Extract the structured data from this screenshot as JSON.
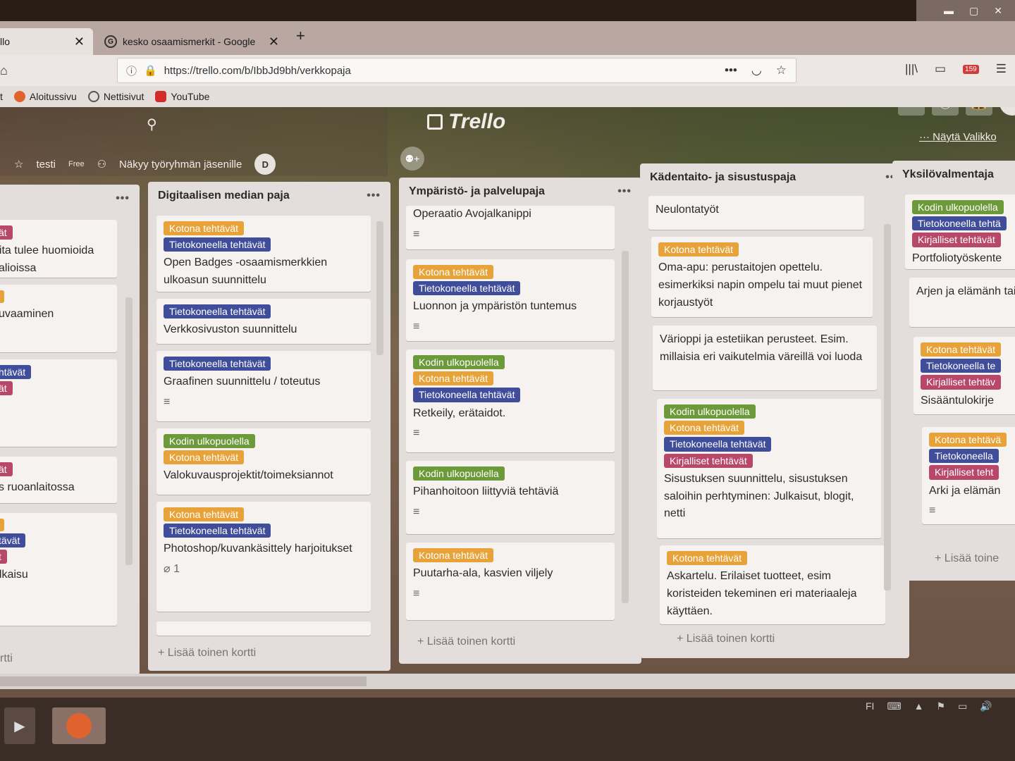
{
  "browser": {
    "tabs": [
      {
        "title": "llo",
        "close": "✕"
      },
      {
        "title": "kesko osaamismerkit - Google",
        "close": "✕"
      }
    ],
    "new_tab": "+",
    "url": "https://trello.com/b/IbbJd9bh/verkkopaja",
    "bookmarks": [
      "Aloitussivu",
      "Nettisivut",
      "YouTube"
    ],
    "notification_count": "159"
  },
  "board": {
    "name": "testi",
    "plan": "Free",
    "visibility": "Näkyy työryhmän jäsenille",
    "member_initial": "D",
    "logo": "Trello",
    "menu_link": "Näytä Valikko",
    "top_avatar": "D"
  },
  "lists": [
    {
      "title": "",
      "cards": [
        {
          "labels": [
            {
              "text": "ät",
              "color": "red"
            }
          ],
          "text": "oita tulee huomioida valioissa"
        },
        {
          "labels": [
            {
              "text": "",
              "color": "orange"
            }
          ],
          "text": "kuvaaminen"
        },
        {
          "labels": [
            {
              "text": "htävät",
              "color": "blue"
            },
            {
              "text": "ät",
              "color": "red"
            }
          ],
          "text": ""
        },
        {
          "labels": [
            {
              "text": "ät",
              "color": "red"
            }
          ],
          "text": "ys ruoanlaitossa"
        },
        {
          "labels": [
            {
              "text": "",
              "color": "orange"
            },
            {
              "text": "tävät",
              "color": "blue"
            },
            {
              "text": "t",
              "color": "red"
            }
          ],
          "text": "ulkaisu"
        }
      ],
      "add": "rtti"
    },
    {
      "title": "Digitaalisen median paja",
      "cards": [
        {
          "labels": [
            {
              "text": "Kotona tehtävät",
              "color": "orange"
            },
            {
              "text": "Tietokoneella tehtävät",
              "color": "blue"
            }
          ],
          "text": "Open Badges -osaamismerkkien ulkoasun suunnittelu"
        },
        {
          "labels": [
            {
              "text": "Tietokoneella tehtävät",
              "color": "blue"
            }
          ],
          "text": "Verkkosivuston suunnittelu"
        },
        {
          "labels": [
            {
              "text": "Tietokoneella tehtävät",
              "color": "blue"
            }
          ],
          "text": "Graafinen suunnittelu / toteutus"
        },
        {
          "labels": [
            {
              "text": "Kodin ulkopuolella",
              "color": "green"
            },
            {
              "text": "Kotona tehtävät",
              "color": "orange"
            }
          ],
          "text": "Valokuvausprojektit/toimeksiannot"
        },
        {
          "labels": [
            {
              "text": "Kotona tehtävät",
              "color": "orange"
            },
            {
              "text": "Tietokoneella tehtävät",
              "color": "blue"
            }
          ],
          "text": "Photoshop/kuvankäsittely harjoitukset",
          "attachments": "1"
        }
      ],
      "add": "+ Lisää toinen kortti"
    },
    {
      "title": "Ympäristö- ja palvelupaja",
      "cards": [
        {
          "labels": [],
          "text": "Operaatio Avojalkanippi"
        },
        {
          "labels": [
            {
              "text": "Kotona tehtävät",
              "color": "orange"
            },
            {
              "text": "Tietokoneella tehtävät",
              "color": "blue"
            }
          ],
          "text": "Luonnon ja ympäristön tuntemus"
        },
        {
          "labels": [
            {
              "text": "Kodin ulkopuolella",
              "color": "green"
            },
            {
              "text": "Kotona tehtävät",
              "color": "orange"
            },
            {
              "text": "Tietokoneella tehtävät",
              "color": "blue"
            }
          ],
          "text": "Retkeily, erätaidot."
        },
        {
          "labels": [
            {
              "text": "Kodin ulkopuolella",
              "color": "green"
            }
          ],
          "text": "Pihanhoitoon liittyviä tehtäviä"
        },
        {
          "labels": [
            {
              "text": "Kotona tehtävät",
              "color": "orange"
            }
          ],
          "text": "Puutarha-ala, kasvien viljely"
        }
      ],
      "add": "+ Lisää toinen kortti"
    },
    {
      "title": "Kädentaito- ja sisustuspaja",
      "cards": [
        {
          "labels": [],
          "text": "Neulontatyöt"
        },
        {
          "labels": [
            {
              "text": "Kotona tehtävät",
              "color": "orange"
            }
          ],
          "text": "Oma-apu: perustaitojen opettelu. esimerkiksi napin ompelu tai muut pienet korjaustyöt"
        },
        {
          "labels": [],
          "text": "Värioppi ja estetiikan perusteet. Esim. millaisia eri vaikutelmia väreillä voi luoda"
        },
        {
          "labels": [
            {
              "text": "Kodin ulkopuolella",
              "color": "green"
            },
            {
              "text": "Kotona tehtävät",
              "color": "orange"
            },
            {
              "text": "Tietokoneella tehtävät",
              "color": "blue"
            },
            {
              "text": "Kirjalliset tehtävät",
              "color": "red"
            }
          ],
          "text": "Sisustuksen suunnittelu, sisustuksen saloihin perhtyminen: Julkaisut, blogit, netti"
        },
        {
          "labels": [
            {
              "text": "Kotona tehtävät",
              "color": "orange"
            }
          ],
          "text": "Askartelu. Erilaiset tuotteet, esim koristeiden tekeminen eri materiaaleja käyttäen."
        }
      ],
      "add": "+ Lisää toinen kortti"
    },
    {
      "title": "Yksilövalmentaja",
      "cards": [
        {
          "labels": [
            {
              "text": "Kodin ulkopuolella",
              "color": "green"
            },
            {
              "text": "Tietokoneella tehtä",
              "color": "blue"
            },
            {
              "text": "Kirjalliset tehtävät",
              "color": "red"
            }
          ],
          "text": "Portfoliotyöskente"
        },
        {
          "labels": [],
          "text": "Arjen ja elämänh taidot"
        },
        {
          "labels": [
            {
              "text": "Kotona tehtävät",
              "color": "orange"
            },
            {
              "text": "Tietokoneella te",
              "color": "blue"
            },
            {
              "text": "Kirjalliset tehtäv",
              "color": "red"
            }
          ],
          "text": "Sisääntulokirje"
        },
        {
          "labels": [
            {
              "text": "Kotona tehtävä",
              "color": "orange"
            },
            {
              "text": "Tietokoneella",
              "color": "blue"
            },
            {
              "text": "Kirjalliset teht",
              "color": "red"
            }
          ],
          "text": "Arki ja elämän"
        }
      ],
      "add": "+ Lisää toine"
    }
  ],
  "tray": {
    "lang": "FI"
  },
  "colors": {
    "orange": "#e7a33a",
    "blue": "#3f4d9a",
    "green": "#6c9a3b",
    "red": "#b8486a"
  }
}
